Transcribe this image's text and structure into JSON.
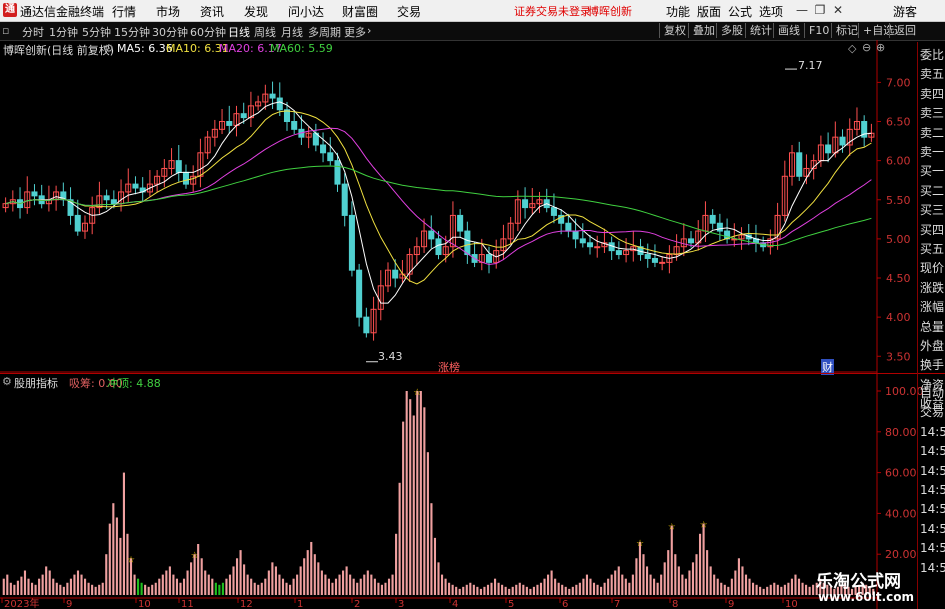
{
  "menubar": {
    "app_title": "通达信金融终端",
    "logo_glyph": "通",
    "items": [
      "行情",
      "市场",
      "资讯",
      "发现",
      "问小达",
      "财富圈",
      "交易"
    ],
    "status_login": "证券交易未登录",
    "stock_name": "博晖创新",
    "right_items": [
      "功能",
      "版面",
      "公式",
      "选项"
    ],
    "guest": "游客"
  },
  "toolbar": {
    "periods": [
      "分时",
      "1分钟",
      "5分钟",
      "15分钟",
      "30分钟",
      "60分钟",
      "日线",
      "周线",
      "月线",
      "多周期",
      "更多"
    ],
    "active_period": "日线",
    "right_buttons": [
      "复权",
      "叠加",
      "多股",
      "统计",
      "画线",
      "F10",
      "标记",
      "+自选",
      "返回"
    ]
  },
  "main_chart": {
    "title": "博晖创新(日线 前复权)",
    "ma_labels": [
      {
        "text": "MA5: 6.36",
        "color": "#ffffff"
      },
      {
        "text": "MA10: 6.31",
        "color": "#f0e040"
      },
      {
        "text": "MA20: 6.17",
        "color": "#e040e0"
      },
      {
        "text": "MA60: 5.59",
        "color": "#40d040"
      }
    ],
    "high_marker": "7.17",
    "low_marker": "3.43",
    "event_tags": [
      "涨榜",
      "财"
    ]
  },
  "sub_chart": {
    "title": "股朋指标",
    "labels": [
      {
        "text": "吸筹: 0.00",
        "color": "#e06060"
      },
      {
        "text": "冲顶: 4.88",
        "color": "#40d040"
      }
    ]
  },
  "side_panel": {
    "labels": [
      "委比",
      "卖五",
      "卖四",
      "卖三",
      "卖二",
      "卖一",
      "买一",
      "买二",
      "买三",
      "买四",
      "买五",
      "现价",
      "涨跌",
      "涨幅",
      "总量",
      "外盘",
      "换手",
      "净资",
      "收益"
    ],
    "lower_labels": [
      "自动",
      "交易",
      "14:56",
      "14:56",
      "14:56",
      "14:56",
      "14:56",
      "14:56",
      "14:56",
      "14:56"
    ]
  },
  "date_axis": [
    "2023年",
    "9",
    "10",
    "11",
    "12",
    "1",
    "2",
    "3",
    "4",
    "5",
    "6",
    "7",
    "8",
    "9",
    "10"
  ],
  "watermark": {
    "big": "乐淘公式网",
    "small": "www.60lt.com"
  },
  "chart_data": [
    {
      "type": "candlestick",
      "title": "博晖创新(日线 前复权)",
      "y_ticks": [
        7.0,
        6.5,
        6.0,
        5.5,
        5.0,
        4.5,
        4.0,
        3.5
      ],
      "ylim": [
        3.35,
        7.35
      ],
      "x_month_labels": [
        "9",
        "10",
        "11",
        "12",
        "1",
        "2",
        "3",
        "4",
        "5",
        "6",
        "7",
        "8",
        "9",
        "10"
      ],
      "close": [
        5.45,
        5.5,
        5.4,
        5.6,
        5.55,
        5.45,
        5.5,
        5.6,
        5.5,
        5.3,
        5.1,
        5.2,
        5.4,
        5.55,
        5.5,
        5.45,
        5.6,
        5.7,
        5.65,
        5.6,
        5.7,
        5.8,
        5.9,
        6.0,
        5.85,
        5.7,
        5.8,
        6.1,
        6.3,
        6.4,
        6.5,
        6.45,
        6.6,
        6.55,
        6.7,
        6.75,
        6.85,
        6.8,
        6.65,
        6.5,
        6.4,
        6.3,
        6.35,
        6.2,
        6.1,
        6.0,
        5.7,
        5.3,
        4.6,
        4.0,
        3.8,
        4.1,
        4.4,
        4.6,
        4.5,
        4.55,
        4.8,
        4.9,
        5.1,
        5.0,
        4.8,
        4.9,
        5.3,
        5.1,
        4.8,
        4.7,
        4.8,
        4.7,
        4.85,
        5.0,
        5.2,
        5.5,
        5.4,
        5.45,
        5.5,
        5.4,
        5.3,
        5.2,
        5.1,
        5.0,
        4.95,
        4.9,
        4.9,
        4.95,
        4.85,
        4.8,
        4.85,
        4.9,
        4.8,
        4.75,
        4.7,
        4.7,
        4.8,
        4.9,
        5.0,
        4.95,
        5.1,
        5.3,
        5.2,
        5.1,
        5.0,
        5.0,
        5.05,
        5.0,
        4.95,
        4.9,
        5.0,
        5.3,
        5.8,
        6.1,
        5.8,
        5.9,
        6.0,
        6.2,
        6.1,
        6.3,
        6.2,
        6.4,
        6.5,
        6.3,
        6.35
      ],
      "ma5_last": 6.36,
      "ma10_last": 6.31,
      "ma20_last": 6.17,
      "ma60_last": 5.59,
      "high": 7.17,
      "low": 3.43
    },
    {
      "type": "bar",
      "title": "股朋指标",
      "y_ticks": [
        100.0,
        80.0,
        60.0,
        40.0,
        20.0
      ],
      "ylim": [
        0,
        100
      ],
      "values": [
        8,
        10,
        6,
        5,
        7,
        9,
        12,
        8,
        6,
        5,
        8,
        10,
        14,
        12,
        8,
        6,
        5,
        4,
        6,
        8,
        10,
        12,
        10,
        8,
        6,
        5,
        4,
        5,
        6,
        20,
        35,
        45,
        38,
        28,
        60,
        30,
        18,
        10,
        8,
        6,
        5,
        4,
        5,
        6,
        8,
        10,
        12,
        14,
        10,
        8,
        6,
        8,
        12,
        16,
        20,
        25,
        18,
        12,
        10,
        8,
        6,
        5,
        6,
        8,
        10,
        14,
        18,
        22,
        15,
        10,
        8,
        6,
        5,
        6,
        8,
        12,
        16,
        14,
        10,
        8,
        6,
        5,
        8,
        10,
        14,
        18,
        22,
        26,
        20,
        16,
        12,
        10,
        8,
        6,
        8,
        10,
        12,
        14,
        10,
        8,
        6,
        8,
        10,
        12,
        10,
        8,
        6,
        5,
        6,
        8,
        10,
        30,
        55,
        85,
        100,
        96,
        88,
        100,
        100,
        92,
        70,
        45,
        28,
        16,
        10,
        8,
        6,
        5,
        4,
        3,
        4,
        5,
        6,
        5,
        4,
        3,
        4,
        5,
        6,
        8,
        6,
        5,
        4,
        3,
        4,
        5,
        6,
        5,
        4,
        3,
        4,
        5,
        6,
        8,
        10,
        12,
        8,
        6,
        5,
        4,
        3,
        4,
        5,
        6,
        8,
        10,
        8,
        6,
        5,
        4,
        6,
        8,
        10,
        12,
        14,
        10,
        8,
        6,
        10,
        18,
        26,
        20,
        14,
        10,
        8,
        6,
        10,
        16,
        22,
        34,
        20,
        14,
        10,
        8,
        12,
        16,
        20,
        30,
        35,
        22,
        14,
        10,
        8,
        6,
        5,
        4,
        8,
        12,
        18,
        14,
        10,
        8,
        6,
        5,
        4,
        3,
        4,
        5,
        6,
        5,
        4,
        5,
        6,
        8,
        10,
        8,
        6,
        5,
        4,
        5,
        6,
        8,
        6,
        5,
        4,
        3,
        4,
        5,
        6,
        4,
        3,
        4,
        5,
        6,
        5,
        4,
        3
      ],
      "green_indices": [
        38,
        39,
        60,
        61,
        62
      ]
    }
  ],
  "colors": {
    "up": "#ff5050",
    "down": "#50d0d0",
    "axis": "#b00000",
    "bar": "#f0a0a0",
    "bar_green": "#20c020"
  }
}
